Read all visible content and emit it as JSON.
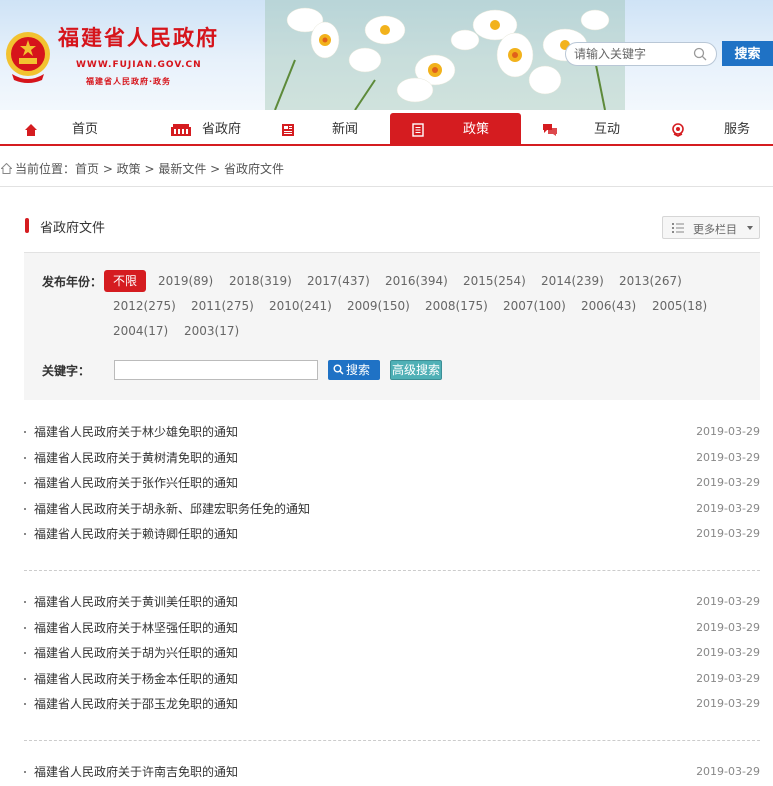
{
  "header": {
    "title": "福建省人民政府",
    "url": "WWW.FUJIAN.GOV.CN",
    "subtitle": "福建省人民政府·政务",
    "search_placeholder": "请输入关键字",
    "search_button": "搜索"
  },
  "nav": [
    {
      "label": "首页",
      "icon": "home-icon",
      "active": false
    },
    {
      "label": "省政府",
      "icon": "building-icon",
      "active": false
    },
    {
      "label": "新闻",
      "icon": "newspaper-icon",
      "active": false
    },
    {
      "label": "政策",
      "icon": "document-icon",
      "active": true
    },
    {
      "label": "互动",
      "icon": "chat-icon",
      "active": false
    },
    {
      "label": "服务",
      "icon": "service-icon",
      "active": false
    }
  ],
  "breadcrumb": "当前位置：首页 > 政策 > 最新文件 > 省政府文件",
  "section": {
    "title": "省政府文件",
    "more_button": "更多栏目"
  },
  "filter": {
    "year_label": "发布年份：",
    "years": [
      "不限",
      "2019(89)",
      "2018(319)",
      "2017(437)",
      "2016(394)",
      "2015(254)",
      "2014(239)",
      "2013(267)",
      "2012(275)",
      "2011(275)",
      "2010(241)",
      "2009(150)",
      "2008(175)",
      "2007(100)",
      "2006(43)",
      "2005(18)",
      "2004(17)",
      "2003(17)"
    ],
    "selected_year": "不限",
    "keyword_label": "关键字：",
    "search_button": "搜索",
    "advanced_button": "高级搜索"
  },
  "doc_groups": [
    [
      {
        "title": "福建省人民政府关于林少雄免职的通知",
        "date": "2019-03-29"
      },
      {
        "title": "福建省人民政府关于黄树清免职的通知",
        "date": "2019-03-29"
      },
      {
        "title": "福建省人民政府关于张作兴任职的通知",
        "date": "2019-03-29"
      },
      {
        "title": "福建省人民政府关于胡永新、邱建宏职务任免的通知",
        "date": "2019-03-29"
      },
      {
        "title": "福建省人民政府关于赖诗卿任职的通知",
        "date": "2019-03-29"
      }
    ],
    [
      {
        "title": "福建省人民政府关于黄训美任职的通知",
        "date": "2019-03-29"
      },
      {
        "title": "福建省人民政府关于林坚强任职的通知",
        "date": "2019-03-29"
      },
      {
        "title": "福建省人民政府关于胡为兴任职的通知",
        "date": "2019-03-29"
      },
      {
        "title": "福建省人民政府关于杨金本任职的通知",
        "date": "2019-03-29"
      },
      {
        "title": "福建省人民政府关于邵玉龙免职的通知",
        "date": "2019-03-29"
      }
    ],
    [
      {
        "title": "福建省人民政府关于许南吉免职的通知",
        "date": "2019-03-29"
      }
    ]
  ],
  "colors": {
    "brand_red": "#d51c20",
    "link_blue": "#1f72c5",
    "adv_teal": "#4fb0b6"
  }
}
